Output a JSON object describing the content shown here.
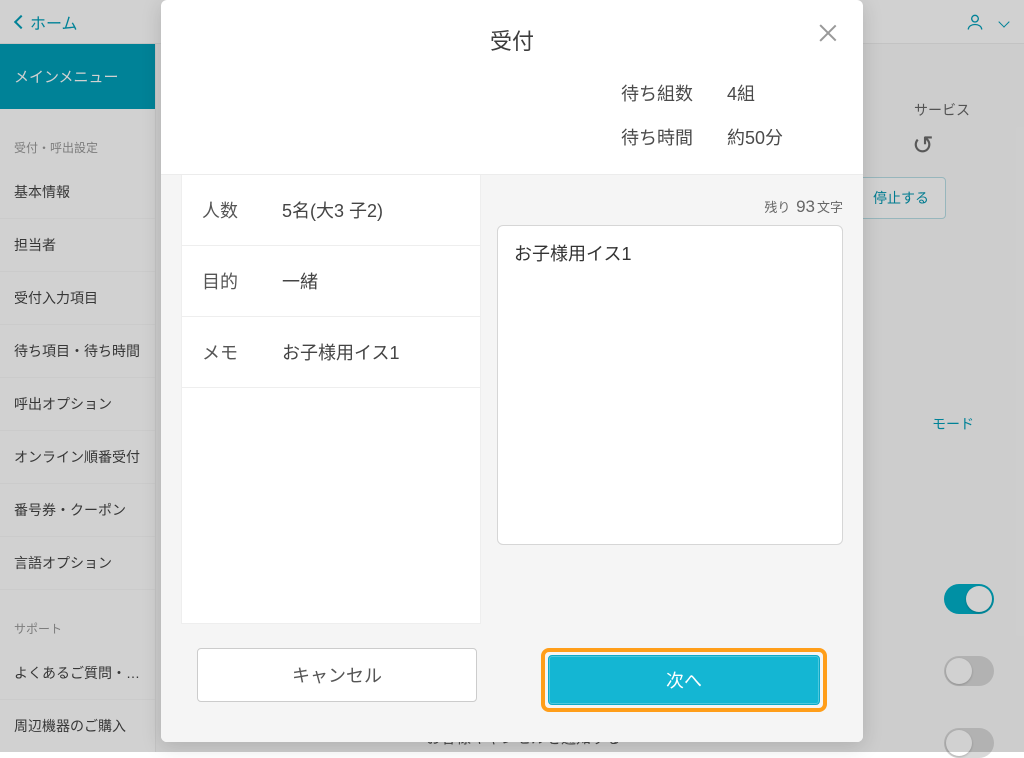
{
  "topbar": {
    "back_label": "ホーム"
  },
  "sidebar": {
    "main_menu": "メインメニュー",
    "section1_label": "受付・呼出設定",
    "items1": {
      "0": "基本情報",
      "1": "担当者",
      "2": "受付入力項目",
      "3": "待ち項目・待ち時間",
      "4": "呼出オプション",
      "5": "オンライン順番受付",
      "6": "番号券・クーポン",
      "7": "言語オプション"
    },
    "section2_label": "サポート",
    "items2": {
      "0": "よくあるご質問・…",
      "1": "周辺機器のご購入"
    }
  },
  "content": {
    "service_label": "サービス",
    "stop_btn": "停止する",
    "mode_label": "モード",
    "bottom_text": "お客様キャンセルを通知する"
  },
  "modal": {
    "title": "受付",
    "waiting_groups_label": "待ち組数",
    "waiting_groups_value": "4組",
    "waiting_time_label": "待ち時間",
    "waiting_time_value": "約50分",
    "summary": {
      "people_label": "人数",
      "people_value": "5名(大3 子2)",
      "purpose_label": "目的",
      "purpose_value": "一緒",
      "memo_label": "メモ",
      "memo_value": "お子様用イス1"
    },
    "char_remain_prefix": "残り",
    "char_remain_count": "93",
    "char_remain_suffix": "文字",
    "note_value": "お子様用イス1",
    "cancel_btn": "キャンセル",
    "next_btn": "次へ"
  }
}
